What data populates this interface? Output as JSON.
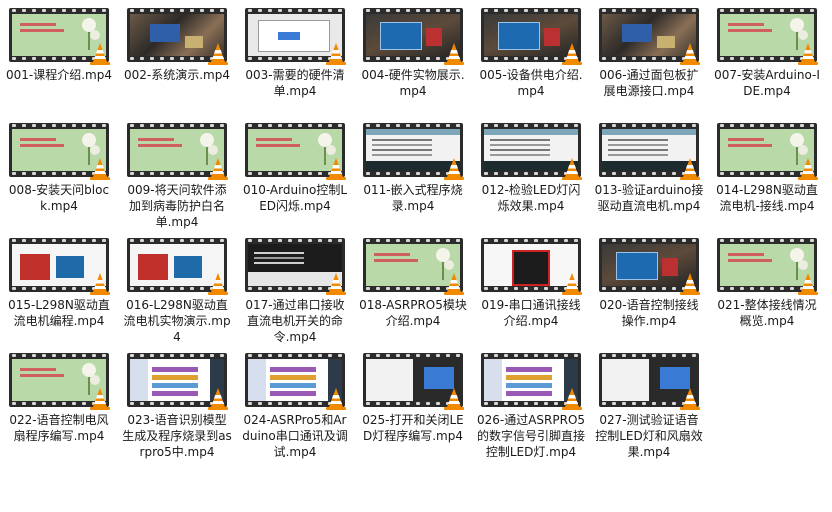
{
  "files": [
    {
      "label": "001-课程介绍.mp4",
      "thumb": "slide"
    },
    {
      "label": "002-系统演示.mp4",
      "thumb": "photo"
    },
    {
      "label": "003-需要的硬件清单.mp4",
      "thumb": "dialog"
    },
    {
      "label": "004-硬件实物展示.mp4",
      "thumb": "board"
    },
    {
      "label": "005-设备供电介绍.mp4",
      "thumb": "board"
    },
    {
      "label": "006-通过面包板扩展电源接口.mp4",
      "thumb": "photo"
    },
    {
      "label": "007-安装Arduino-IDE.mp4",
      "thumb": "slide"
    },
    {
      "label": "008-安装天问block.mp4",
      "thumb": "slide"
    },
    {
      "label": "009-将天问软件添加到病毒防护白名单.mp4",
      "thumb": "slide"
    },
    {
      "label": "010-Arduino控制LED闪烁.mp4",
      "thumb": "slide"
    },
    {
      "label": "011-嵌入式程序烧录.mp4",
      "thumb": "code"
    },
    {
      "label": "012-检验LED灯闪烁效果.mp4",
      "thumb": "code"
    },
    {
      "label": "013-验证arduino接驱动直流电机.mp4",
      "thumb": "code"
    },
    {
      "label": "014-L298N驱动直流电机-接线.mp4",
      "thumb": "slide"
    },
    {
      "label": "015-L298N驱动直流电机编程.mp4",
      "thumb": "l298"
    },
    {
      "label": "016-L298N驱动直流电机实物演示.mp4",
      "thumb": "l298"
    },
    {
      "label": "017-通过串口接收直流电机开关的命令.mp4",
      "thumb": "term"
    },
    {
      "label": "018-ASRPRO5模块介绍.mp4",
      "thumb": "slide"
    },
    {
      "label": "019-串口通讯接线介绍.mp4",
      "thumb": "asr"
    },
    {
      "label": "020-语音控制接线操作.mp4",
      "thumb": "board"
    },
    {
      "label": "021-整体接线情况概览.mp4",
      "thumb": "slide"
    },
    {
      "label": "022-语音控制电风扇程序编写.mp4",
      "thumb": "slide"
    },
    {
      "label": "023-语音识别模型生成及程序烧录到asrpro5中.mp4",
      "thumb": "blocks"
    },
    {
      "label": "024-ASRPro5和Arduino串口通讯及调试.mp4",
      "thumb": "blocks"
    },
    {
      "label": "025-打开和关闭LED灯程序编写.mp4",
      "thumb": "mixed"
    },
    {
      "label": "026-通过ASRPRO5的数字信号引脚直接控制LED灯.mp4",
      "thumb": "blocks"
    },
    {
      "label": "027-测试验证语音控制LED灯和风扇效果.mp4",
      "thumb": "mixed"
    }
  ]
}
